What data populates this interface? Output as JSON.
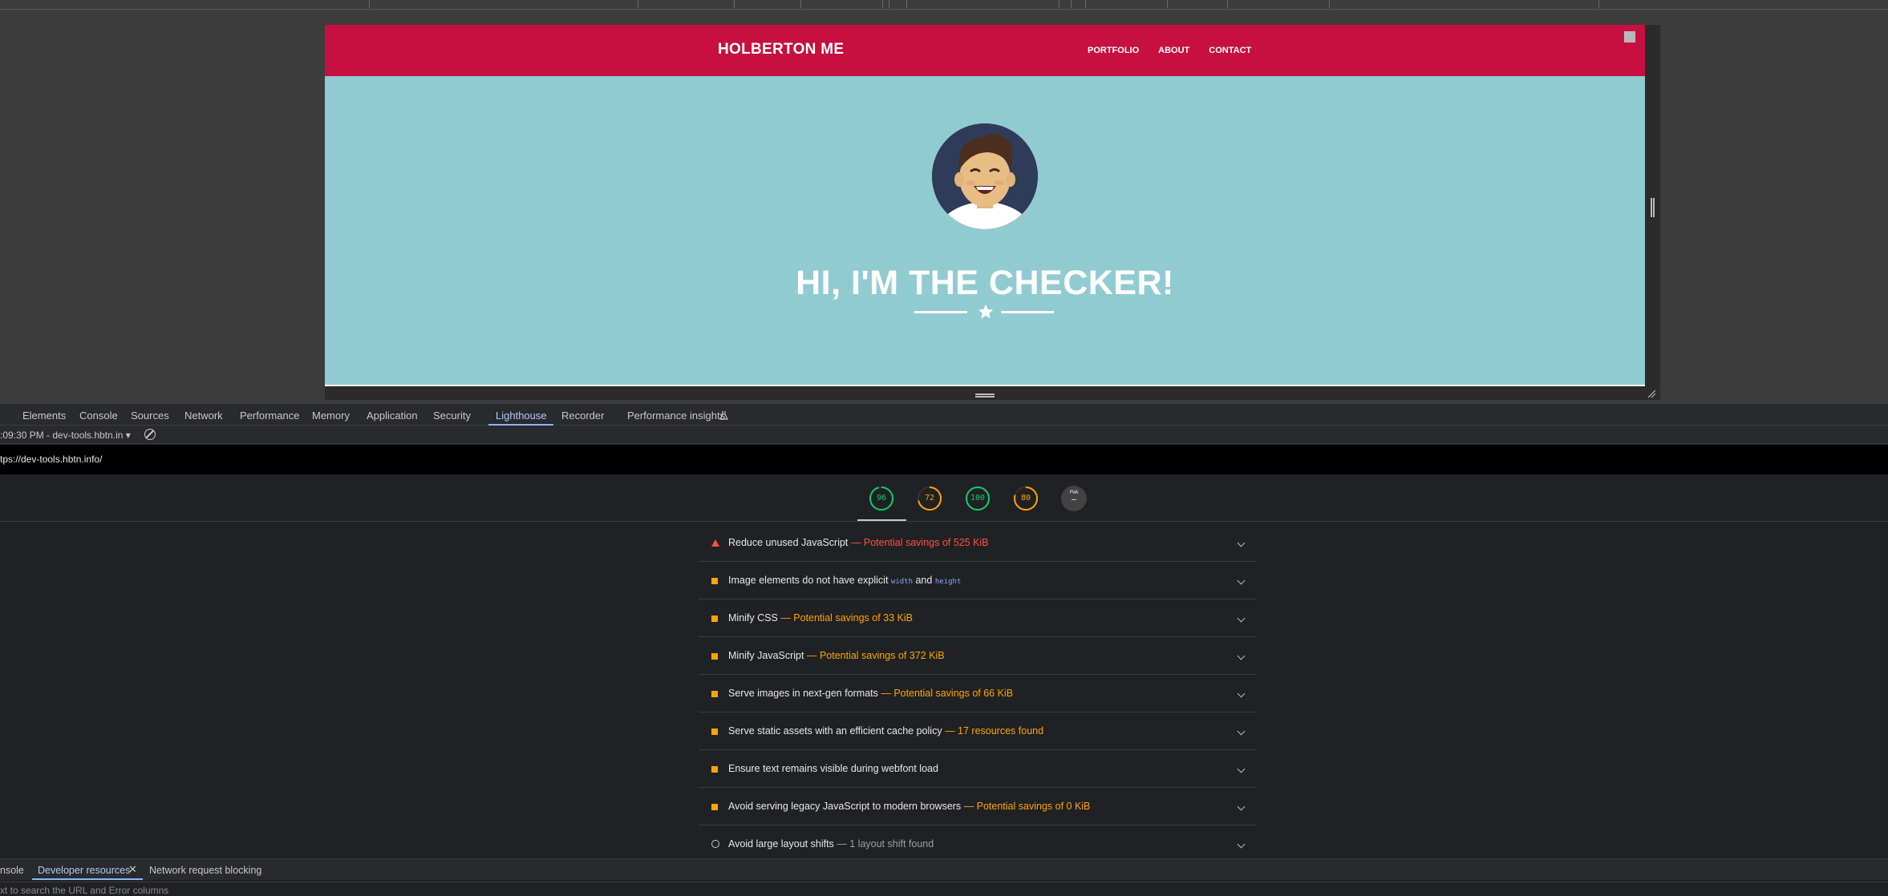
{
  "page": {
    "brand": "HOLBERTON ME",
    "nav_links": [
      "PORTFOLIO",
      "ABOUT",
      "CONTACT"
    ],
    "hero_title": "HI, I'M THE CHECKER!"
  },
  "devtools": {
    "tabs": [
      "Elements",
      "Console",
      "Sources",
      "Network",
      "Performance",
      "Memory",
      "Application",
      "Security",
      "Lighthouse",
      "Recorder",
      "Performance insights"
    ],
    "active_tab": "Lighthouse",
    "report_select": ":09:30 PM - dev-tools.hbtn.in",
    "url": "tps://dev-tools.hbtn.info/",
    "scores": [
      {
        "value": "96",
        "fraction": 0.96,
        "color": "#0cce6b"
      },
      {
        "value": "72",
        "fraction": 0.72,
        "color": "#ffa400"
      },
      {
        "value": "100",
        "fraction": 1.0,
        "color": "#0cce6b"
      },
      {
        "value": "80",
        "fraction": 0.8,
        "color": "#ffa400"
      },
      {
        "value": "—",
        "label": "PWA",
        "fraction": 0,
        "color": "#bbbbbb"
      }
    ],
    "audits": [
      {
        "icon": "fail-triangle-icon",
        "title": "Reduce unused JavaScript",
        "detail": "— Potential savings of 525 KiB",
        "detail_color": "#ff4e42"
      },
      {
        "icon": "warning-square-icon",
        "title_pre": "Image elements do not have explicit ",
        "code1": "width",
        "mid": " and ",
        "code2": "height"
      },
      {
        "icon": "warning-square-icon",
        "title": "Minify CSS",
        "detail": "— Potential savings of 33 KiB",
        "detail_color": "#ffa400"
      },
      {
        "icon": "warning-square-icon",
        "title": "Minify JavaScript",
        "detail": "— Potential savings of 372 KiB",
        "detail_color": "#ffa400"
      },
      {
        "icon": "warning-square-icon",
        "title": "Serve images in next-gen formats",
        "detail": "— Potential savings of 66 KiB",
        "detail_color": "#ffa400"
      },
      {
        "icon": "warning-square-icon",
        "title": "Serve static assets with an efficient cache policy",
        "detail": "— 17 resources found",
        "detail_color": "#ffa400"
      },
      {
        "icon": "warning-square-icon",
        "title": "Ensure text remains visible during webfont load",
        "detail": "",
        "detail_color": "#ffa400"
      },
      {
        "icon": "warning-square-icon",
        "title": "Avoid serving legacy JavaScript to modern browsers",
        "detail": "— Potential savings of 0 KiB",
        "detail_color": "#ffa400"
      },
      {
        "icon": "info-circle-icon",
        "title": "Avoid large layout shifts",
        "detail": "— 1 layout shift found",
        "detail_color": "#9aa0a6"
      }
    ],
    "drawer": {
      "tabs": [
        "nsole",
        "Developer resources",
        "Network request blocking"
      ],
      "active": "Developer resources",
      "filter_placeholder": "xt to search the URL and Error columns"
    }
  },
  "colors": {
    "nav_bg": "#c7103f",
    "hero_bg": "#91cbd2",
    "devtools_bg": "#202124",
    "accent": "#8ab4f8"
  }
}
